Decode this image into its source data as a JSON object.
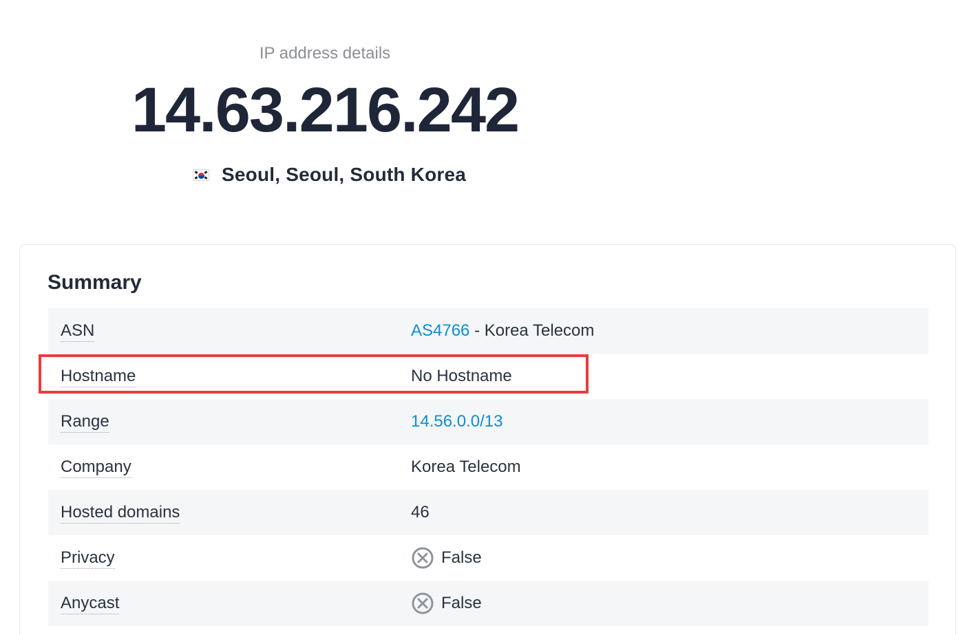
{
  "hero": {
    "label": "IP address details",
    "ip": "14.63.216.242",
    "location": "Seoul, Seoul, South Korea",
    "flag_icon": "south-korea-flag-icon"
  },
  "summary": {
    "title": "Summary",
    "rows": [
      {
        "key": "ASN",
        "value_link": "AS4766",
        "value_rest": " - Korea Telecom"
      },
      {
        "key": "Hostname",
        "value": "No Hostname"
      },
      {
        "key": "Range",
        "value_link": "14.56.0.0/13"
      },
      {
        "key": "Company",
        "value": "Korea Telecom"
      },
      {
        "key": "Hosted domains",
        "value": "46"
      },
      {
        "key": "Privacy",
        "value": "False",
        "icon": "x-circle-icon"
      },
      {
        "key": "Anycast",
        "value": "False",
        "icon": "x-circle-icon"
      }
    ]
  },
  "colors": {
    "link": "#0a8fd8",
    "highlight": "#ea3c3c",
    "row_shade": "#f5f6f7"
  }
}
